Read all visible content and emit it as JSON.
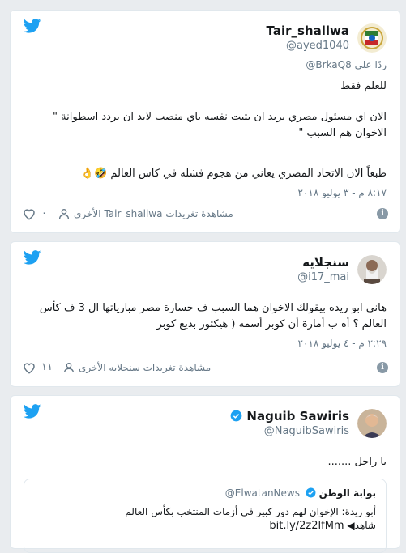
{
  "tweets": [
    {
      "display_name": "Tair_shallwa",
      "handle": "@ayed1040",
      "reply_to_prefix": "ردًا على",
      "reply_to_handle": "@BrkaQ8",
      "lines": [
        "للعلم فقط",
        "الان اي مسئول مصري يريد ان يثبت نفسه باي منصب لابد ان يردد اسطوانة \" الاخوان هم السبب \"",
        "طبعاً الان الاتحاد المصري يعاني من هجوم فشله في كاس العالم 🤣👌"
      ],
      "timestamp": "٨:١٧ م - ٣ يوليو ٢٠١٨",
      "likes": "٠",
      "more_label": "مشاهدة تغريدات Tair_shallwa الأخرى"
    },
    {
      "display_name": "سنجلايه",
      "handle": "@i17_mai",
      "lines": [
        "هاني ابو ريده بيقولك الاخوان هما السبب ف خسارة مصر مبارياتها ال 3 ف كأس العالم ؟ أه ب أمارة أن كوبر أسمه ( هيكتور بديع كوبر"
      ],
      "timestamp": "٢:٢٩ م - ٤ يوليو ٢٠١٨",
      "likes": "١١",
      "more_label": "مشاهدة تغريدات سنجلايه الأخرى"
    },
    {
      "display_name": "Naguib Sawiris",
      "handle": "@NaguibSawiris",
      "lines": [
        "يا راجل ......."
      ],
      "quote": {
        "name": "بوابة الوطن",
        "handle": "@ElwatanNews",
        "text": "أبو ريدة: الإخوان لهم دور كبير في أزمات المنتخب بكأس العالم",
        "link_prefix": "شاهد◀",
        "link": "bit.ly/2z2lfMm"
      }
    }
  ],
  "colors": {
    "twitter_blue": "#1da1f2",
    "verified": "#1da1f2",
    "muted": "#657786"
  }
}
